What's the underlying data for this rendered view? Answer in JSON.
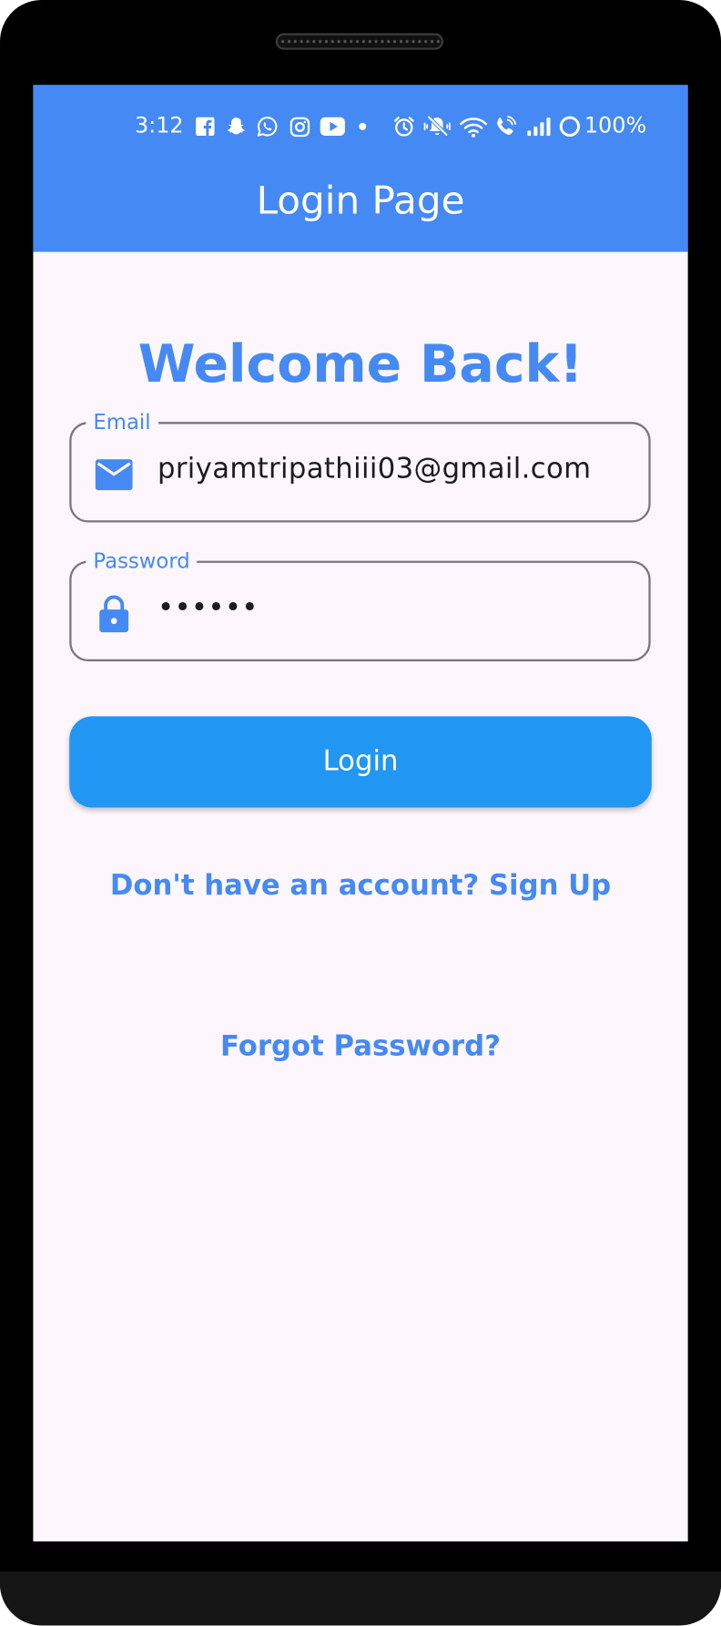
{
  "status_bar": {
    "time": "3:12",
    "battery": "100%",
    "notification_icons": [
      "facebook-icon",
      "snapchat-icon",
      "whatsapp-icon",
      "instagram-icon",
      "youtube-icon",
      "more-dot-icon"
    ],
    "system_icons": [
      "alarm-icon",
      "mute-icon",
      "wifi-icon",
      "wifi-call-icon",
      "signal-icon",
      "battery-icon"
    ]
  },
  "app_bar": {
    "title": "Login Page"
  },
  "main": {
    "heading": "Welcome Back!",
    "email": {
      "label": "Email",
      "value": "priyamtripathiii03@gmail.com",
      "icon": "mail-icon"
    },
    "password": {
      "label": "Password",
      "value": "••••••",
      "icon": "lock-icon"
    },
    "login_button": "Login",
    "signup_link": "Don't have an account? Sign Up",
    "forgot_link": "Forgot Password?"
  },
  "colors": {
    "app_bar": "#4589f5",
    "button": "#2196f3",
    "background": "#fdf7fd",
    "outline": "#79747e"
  }
}
